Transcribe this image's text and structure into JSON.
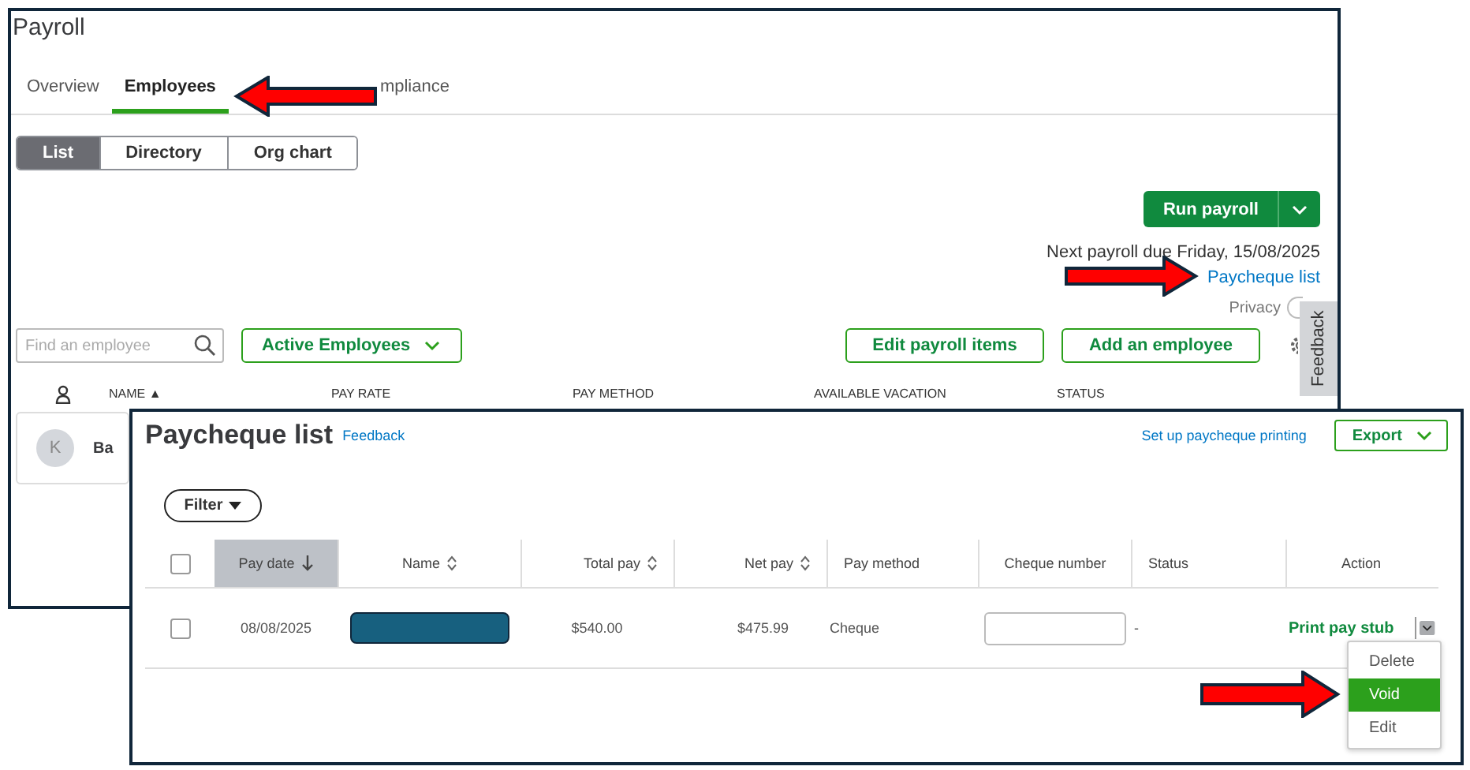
{
  "payroll_window": {
    "title": "Payroll",
    "tabs": [
      {
        "label": "Overview",
        "selected": false
      },
      {
        "label": "Employees",
        "selected": true
      },
      {
        "label": "mpliance",
        "selected": false
      }
    ],
    "views": [
      {
        "label": "List",
        "selected": true
      },
      {
        "label": "Directory",
        "selected": false
      },
      {
        "label": "Org chart",
        "selected": false
      }
    ],
    "run_payroll": "Run payroll",
    "next_payroll": "Next payroll due Friday, 15/08/2025",
    "paycheque_link": "Paycheque list",
    "privacy": {
      "label": "Privacy",
      "on": false
    },
    "feedback_tab": "Feedback",
    "search": {
      "placeholder": "Find an employee"
    },
    "employee_filter": "Active Employees",
    "buttons": [
      "Edit payroll items",
      "Add an employee"
    ],
    "columns": [
      "NAME ▲",
      "PAY RATE",
      "PAY METHOD",
      "AVAILABLE VACATION",
      "STATUS"
    ],
    "employee_row": {
      "initial": "K",
      "name": "Ba"
    }
  },
  "paycheque_window": {
    "title": "Paycheque list",
    "feedback": "Feedback",
    "setup_link": "Set up paycheque printing",
    "export": "Export",
    "filter": "Filter",
    "select_all_checked": false,
    "columns": [
      {
        "label": "Pay date",
        "sortable": true,
        "selected": true
      },
      {
        "label": "Name",
        "sortable": true,
        "selected": false
      },
      {
        "label": "Total pay",
        "sortable": true,
        "selected": false
      },
      {
        "label": "Net pay",
        "sortable": true,
        "selected": false
      },
      {
        "label": "Pay method",
        "sortable": false,
        "selected": false
      },
      {
        "label": "Cheque number",
        "sortable": false,
        "selected": false
      },
      {
        "label": "Status",
        "sortable": false,
        "selected": false
      },
      {
        "label": "Action",
        "sortable": false,
        "selected": false
      }
    ],
    "rows": [
      {
        "checked": false,
        "pay_date": "08/08/2025",
        "name_redacted": true,
        "total_pay": "$540.00",
        "net_pay": "$475.99",
        "pay_method": "Cheque",
        "status": "-",
        "action": "Print pay stub"
      }
    ],
    "action_menu": [
      {
        "label": "Delete",
        "selected": false
      },
      {
        "label": "Void",
        "selected": true
      },
      {
        "label": "Edit",
        "selected": false
      }
    ]
  }
}
